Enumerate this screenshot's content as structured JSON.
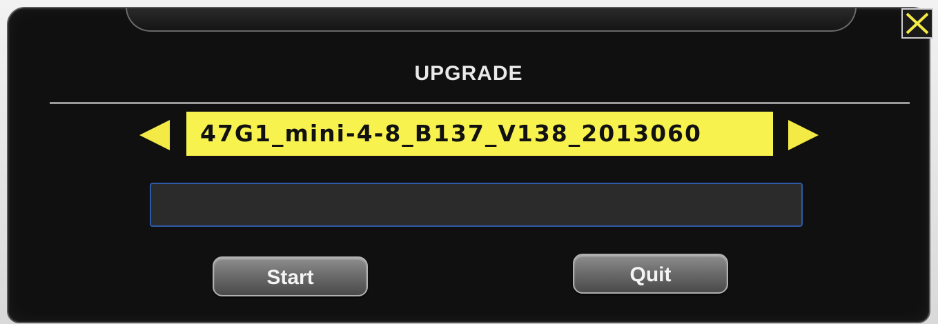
{
  "dialog": {
    "title": "UPGRADE",
    "file_name": "47G1_mini-4-8_B137_V138_2013060",
    "progress": 0,
    "buttons": {
      "start_label": "Start",
      "quit_label": "Quit"
    }
  },
  "icons": {
    "prev": "left-arrow-icon",
    "next": "right-arrow-icon",
    "close": "close-icon"
  },
  "colors": {
    "accent": "#f8f24f",
    "progress_border": "#2e5aa8",
    "dialog_bg": "#101010"
  }
}
